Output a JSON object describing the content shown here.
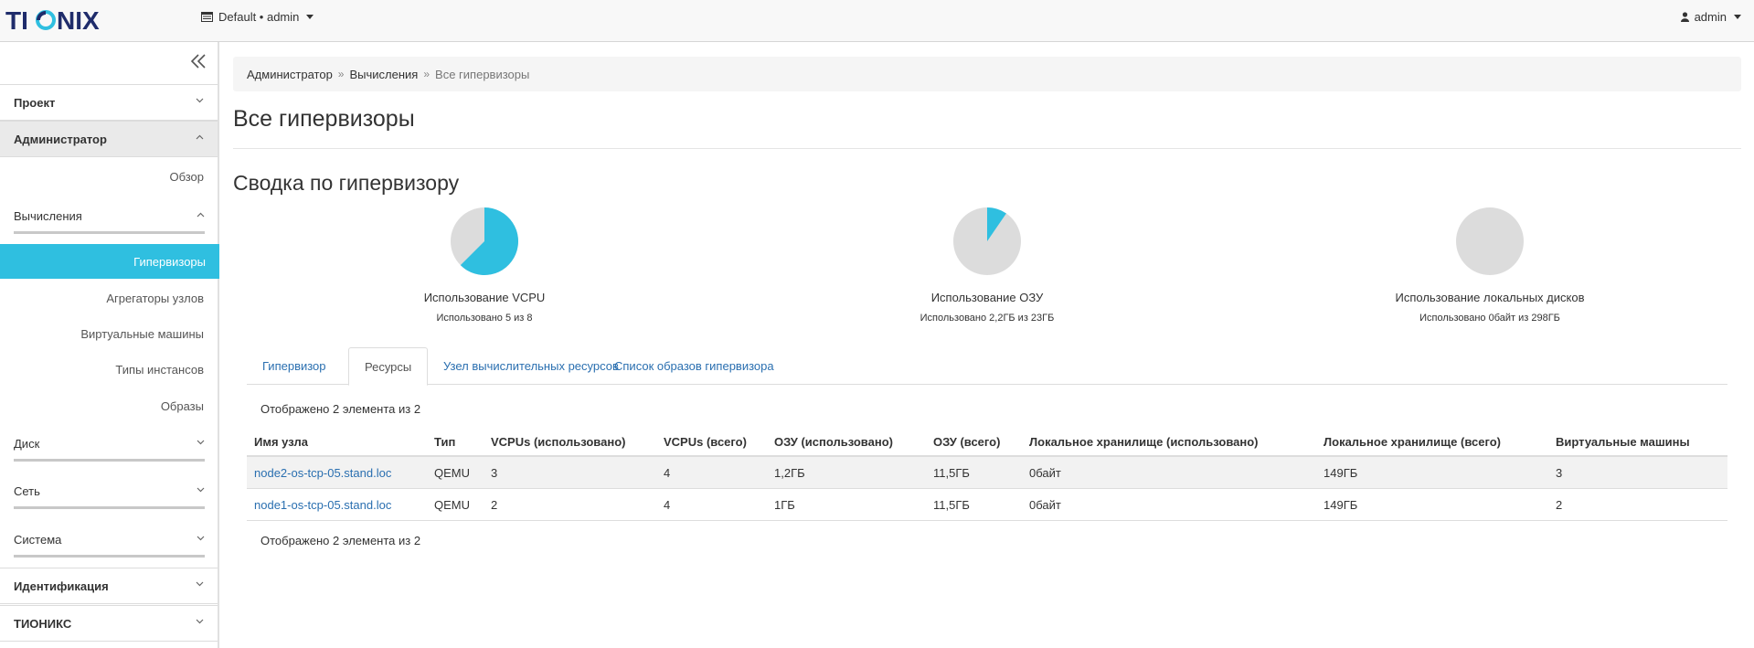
{
  "brand": {
    "logo_text": "TIONIX"
  },
  "header": {
    "project_switch": "Default • admin",
    "user_menu": "admin"
  },
  "sidebar": {
    "sections": {
      "project": "Проект",
      "admin": "Администратор",
      "identity": "Идентификация",
      "tionix": "ТИОНИКС"
    },
    "admin_items": {
      "overview": "Обзор",
      "compute": "Вычисления",
      "hypervisors": "Гипервизоры",
      "aggregates": "Агрегаторы узлов",
      "instances": "Виртуальные машины",
      "flavors": "Типы инстансов",
      "images": "Образы",
      "volume": "Диск",
      "network": "Сеть",
      "system": "Система"
    }
  },
  "breadcrumb": {
    "items": [
      "Администратор",
      "Вычисления"
    ],
    "current": "Все гипервизоры"
  },
  "page": {
    "title": "Все гипервизоры",
    "summary_title": "Сводка по гипервизору"
  },
  "pies": [
    {
      "label": "Использование VCPU",
      "sub": "Использовано 5 из 8",
      "used_fraction": 0.625
    },
    {
      "label": "Использование ОЗУ",
      "sub": "Использовано 2,2ГБ из 23ГБ",
      "used_fraction": 0.0957
    },
    {
      "label": "Использование локальных дисков",
      "sub": "Использовано 0байт из 298ГБ",
      "used_fraction": 0
    }
  ],
  "colors": {
    "accent": "#2fbfe0",
    "pie_bg": "#dcdcdc",
    "link": "#2a6fb0"
  },
  "tabs": [
    "Гипервизор",
    "Ресурсы",
    "Узел вычислительных ресурсов",
    "Список образов гипервизора"
  ],
  "active_tab": "Ресурсы",
  "table": {
    "count_text": "Отображено 2 элемента из 2",
    "columns": [
      "Имя узла",
      "Тип",
      "VCPUs (использовано)",
      "VCPUs (всего)",
      "ОЗУ (использовано)",
      "ОЗУ (всего)",
      "Локальное хранилище (использовано)",
      "Локальное хранилище (всего)",
      "Виртуальные машины"
    ],
    "rows": [
      [
        "node2-os-tcp-05.stand.loc",
        "QEMU",
        "3",
        "4",
        "1,2ГБ",
        "11,5ГБ",
        "0байт",
        "149ГБ",
        "3"
      ],
      [
        "node1-os-tcp-05.stand.loc",
        "QEMU",
        "2",
        "4",
        "1ГБ",
        "11,5ГБ",
        "0байт",
        "149ГБ",
        "2"
      ]
    ]
  }
}
